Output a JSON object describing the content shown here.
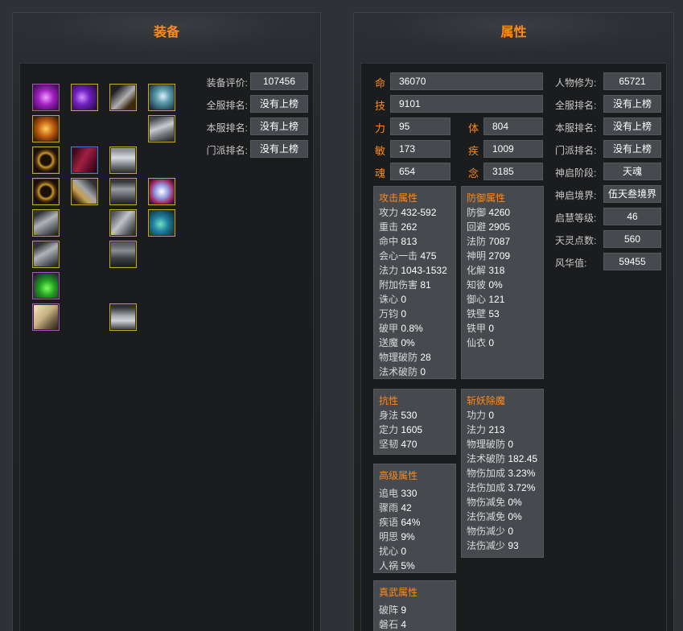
{
  "equip": {
    "title": "装备",
    "labels": {
      "score": "装备评价:",
      "server_rank": "全服排名:",
      "local_rank": "本服排名:",
      "sect_rank": "门派排名:"
    },
    "values": {
      "score": "107456",
      "server_rank": "没有上榜",
      "local_rank": "没有上榜",
      "sect_rank": "没有上榜"
    }
  },
  "attr": {
    "title": "属性",
    "base": {
      "ming_k": "命",
      "ming_v": "36070",
      "ji_k": "技",
      "ji_v": "9101",
      "li_k": "力",
      "li_v": "95",
      "ti_k": "体",
      "ti_v": "804",
      "min_k": "敏",
      "min_v": "173",
      "ji2_k": "疾",
      "ji2_v": "1009",
      "hun_k": "魂",
      "hun_v": "654",
      "nian_k": "念",
      "nian_v": "3185"
    },
    "side": [
      {
        "k": "人物修为:",
        "v": "65721"
      },
      {
        "k": "全服排名:",
        "v": "没有上榜"
      },
      {
        "k": "本服排名:",
        "v": "没有上榜"
      },
      {
        "k": "门派排名:",
        "v": "没有上榜"
      },
      {
        "k": "神启阶段:",
        "v": "天魂"
      },
      {
        "k": "神启境界:",
        "v": "伍天叁境界"
      },
      {
        "k": "启慧等级:",
        "v": "46"
      },
      {
        "k": "天灵点数:",
        "v": "560"
      },
      {
        "k": "风华值:",
        "v": "59455"
      }
    ],
    "attack": {
      "title": "攻击属性",
      "rows": [
        {
          "k": "攻力",
          "v": "432-592"
        },
        {
          "k": "重击",
          "v": "262"
        },
        {
          "k": "命中",
          "v": "813"
        },
        {
          "k": "会心一击",
          "v": "475"
        },
        {
          "k": "法力",
          "v": "1043-1532"
        },
        {
          "k": "附加伤害",
          "v": "81"
        },
        {
          "k": "诛心",
          "v": "0"
        },
        {
          "k": "万钧",
          "v": "0"
        },
        {
          "k": "破甲",
          "v": "0.8%"
        },
        {
          "k": "送魔",
          "v": "0%"
        },
        {
          "k": "物理破防",
          "v": "28"
        },
        {
          "k": "法术破防",
          "v": "0"
        }
      ]
    },
    "defense": {
      "title": "防御属性",
      "rows": [
        {
          "k": "防御",
          "v": "4260"
        },
        {
          "k": "回避",
          "v": "2905"
        },
        {
          "k": "法防",
          "v": "7087"
        },
        {
          "k": "神明",
          "v": "2709"
        },
        {
          "k": "化解",
          "v": "318"
        },
        {
          "k": "知彼",
          "v": "0%"
        },
        {
          "k": "御心",
          "v": "121"
        },
        {
          "k": "铁壁",
          "v": "53"
        },
        {
          "k": "铁甲",
          "v": "0"
        },
        {
          "k": "仙衣",
          "v": "0"
        }
      ]
    },
    "resist": {
      "title": "抗性",
      "rows": [
        {
          "k": "身法",
          "v": "530"
        },
        {
          "k": "定力",
          "v": "1605"
        },
        {
          "k": "坚韧",
          "v": "470"
        }
      ]
    },
    "demon": {
      "title": "斩妖除魔",
      "rows": [
        {
          "k": "功力",
          "v": "0"
        },
        {
          "k": "法力",
          "v": "213"
        },
        {
          "k": "物理破防",
          "v": "0"
        },
        {
          "k": "法术破防",
          "v": "182.45"
        },
        {
          "k": "物伤加成",
          "v": "3.23%"
        },
        {
          "k": "法伤加成",
          "v": "3.72%"
        },
        {
          "k": "物伤减免",
          "v": "0%"
        },
        {
          "k": "法伤减免",
          "v": "0%"
        },
        {
          "k": "物伤减少",
          "v": "0"
        },
        {
          "k": "法伤减少",
          "v": "93"
        }
      ]
    },
    "advanced": {
      "title": "高级属性",
      "rows": [
        {
          "k": "追电",
          "v": "330"
        },
        {
          "k": "骤雨",
          "v": "42"
        },
        {
          "k": "疾语",
          "v": "64%"
        },
        {
          "k": "明思",
          "v": "9%"
        },
        {
          "k": "扰心",
          "v": "0"
        },
        {
          "k": "人祸",
          "v": "5%"
        }
      ]
    },
    "martial": {
      "title": "真武属性",
      "rows": [
        {
          "k": "破阵",
          "v": "9"
        },
        {
          "k": "磐石",
          "v": "4"
        }
      ]
    }
  }
}
